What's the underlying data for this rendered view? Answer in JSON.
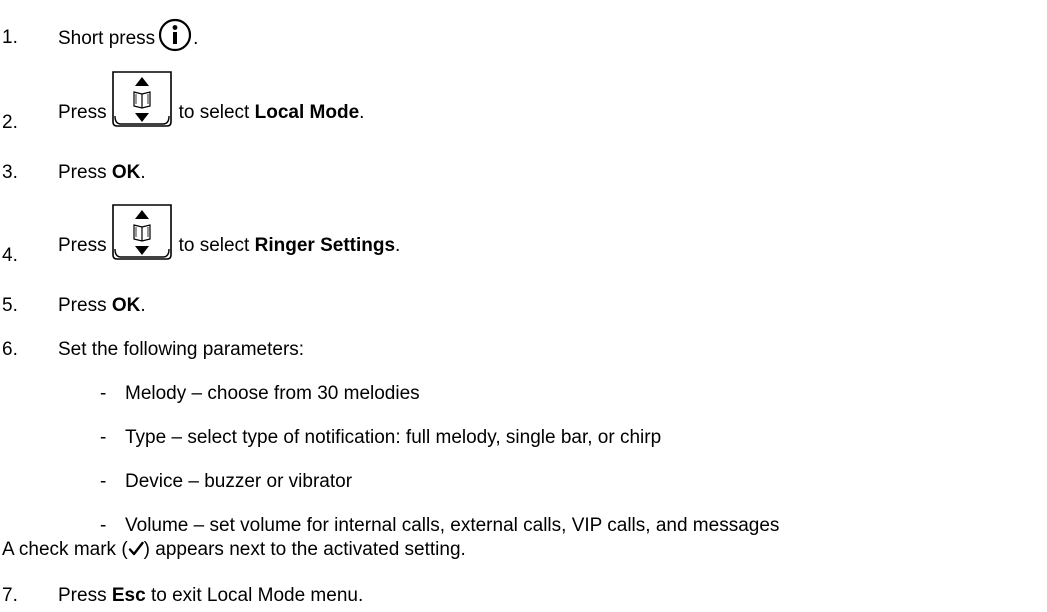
{
  "steps": [
    {
      "num": "1.",
      "text_before": "Short press",
      "icon": "info-icon",
      "text_after": "."
    },
    {
      "num": "2.",
      "text_before": "Press",
      "icon": "navigation-key-icon",
      "text_mid": "to select",
      "bold": "Local Mode",
      "text_after": "."
    },
    {
      "num": "3.",
      "text_before": "Press",
      "bold": "OK",
      "text_after": "."
    },
    {
      "num": "4.",
      "text_before": "Press",
      "icon": "navigation-key-icon",
      "text_mid": "to select",
      "bold": "Ringer Settings",
      "text_after": "."
    },
    {
      "num": "5.",
      "text_before": "Press",
      "bold": "OK",
      "text_after": "."
    },
    {
      "num": "6.",
      "text": "Set the following parameters:"
    },
    {
      "num": "7.",
      "text_before": "Press",
      "bold": "Esc",
      "text_after": "to exit Local Mode menu."
    }
  ],
  "parameters": [
    {
      "dash": "-",
      "text": "Melody – choose from 30 melodies"
    },
    {
      "dash": "-",
      "text": "Type – select type of notification: full melody, single bar, or chirp"
    },
    {
      "dash": "-",
      "text": "Device – buzzer or vibrator"
    },
    {
      "dash": "-",
      "text": "Volume – set volume for internal calls, external calls, VIP calls, and messages"
    }
  ],
  "note": {
    "before": "A check mark (",
    "icon": "check-mark-icon",
    "after": ") appears next to the activated setting."
  }
}
